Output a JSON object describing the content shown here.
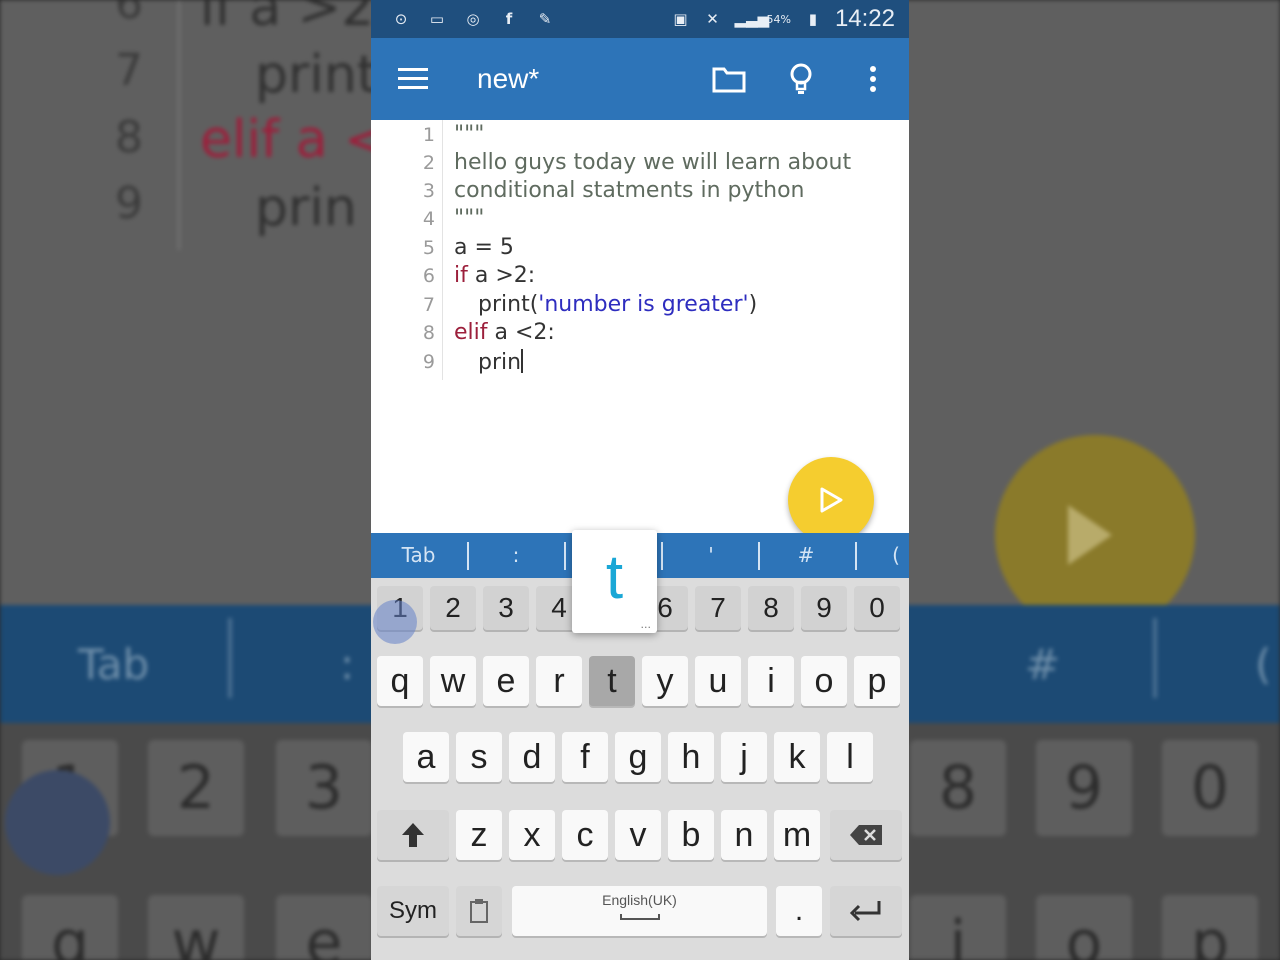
{
  "background": {
    "line_numbers": [
      "6",
      "7",
      "8",
      "9"
    ],
    "code_fragments": [
      "if a >2:",
      "print",
      "elif a <",
      "prin"
    ],
    "keybar": [
      "Tab",
      ":",
      "#",
      "("
    ],
    "number_keys": [
      "1",
      "2",
      "3",
      "8",
      "9",
      "0"
    ],
    "letter_keys": [
      "q",
      "w",
      "e",
      "i",
      "o",
      "p"
    ]
  },
  "status_bar": {
    "battery": "54%",
    "time": "14:22"
  },
  "app_bar": {
    "title": "new*"
  },
  "editor": {
    "lines": [
      {
        "num": "1",
        "text": "\"\"\""
      },
      {
        "num": "2",
        "text": "hello guys today we will learn about"
      },
      {
        "num": "3",
        "text": "conditional statments in python"
      },
      {
        "num": "4",
        "text": "\"\"\""
      },
      {
        "num": "5",
        "text": "a = 5"
      },
      {
        "num": "6",
        "kw": "if",
        "rest": " a >2:"
      },
      {
        "num": "7",
        "pre": "print(",
        "str": "'number is greater'",
        "post": ")"
      },
      {
        "num": "8",
        "kw": "elif",
        "rest": " a <2:"
      },
      {
        "num": "9",
        "text": "prin"
      }
    ]
  },
  "symbol_bar": {
    "items": [
      "Tab",
      ":",
      "'",
      "#",
      "("
    ]
  },
  "keyboard": {
    "number_row": [
      "1",
      "2",
      "3",
      "4",
      "5",
      "6",
      "7",
      "8",
      "9",
      "0"
    ],
    "row1": [
      "q",
      "w",
      "e",
      "r",
      "t",
      "y",
      "u",
      "i",
      "o",
      "p"
    ],
    "row2": [
      "a",
      "s",
      "d",
      "f",
      "g",
      "h",
      "j",
      "k",
      "l"
    ],
    "row3": [
      "z",
      "x",
      "c",
      "v",
      "b",
      "n",
      "m"
    ],
    "sym_label": "Sym",
    "space_label": "English(UK)",
    "period_label": ".",
    "popup_letter": "t",
    "popup_dots": "...",
    "pressed_key": "t"
  },
  "colors": {
    "status_bar": "#1f4f7e",
    "app_bar": "#2d74b8",
    "fab": "#f5cd2f",
    "keyword": "#9c1f3b",
    "string": "#2e2dbf",
    "popup_letter": "#1aa7d6"
  },
  "icons": [
    "menu-icon",
    "folder-icon",
    "lightbulb-icon",
    "more-vert-icon",
    "play-icon",
    "shift-icon",
    "backspace-icon",
    "enter-icon",
    "clipboard-icon"
  ]
}
